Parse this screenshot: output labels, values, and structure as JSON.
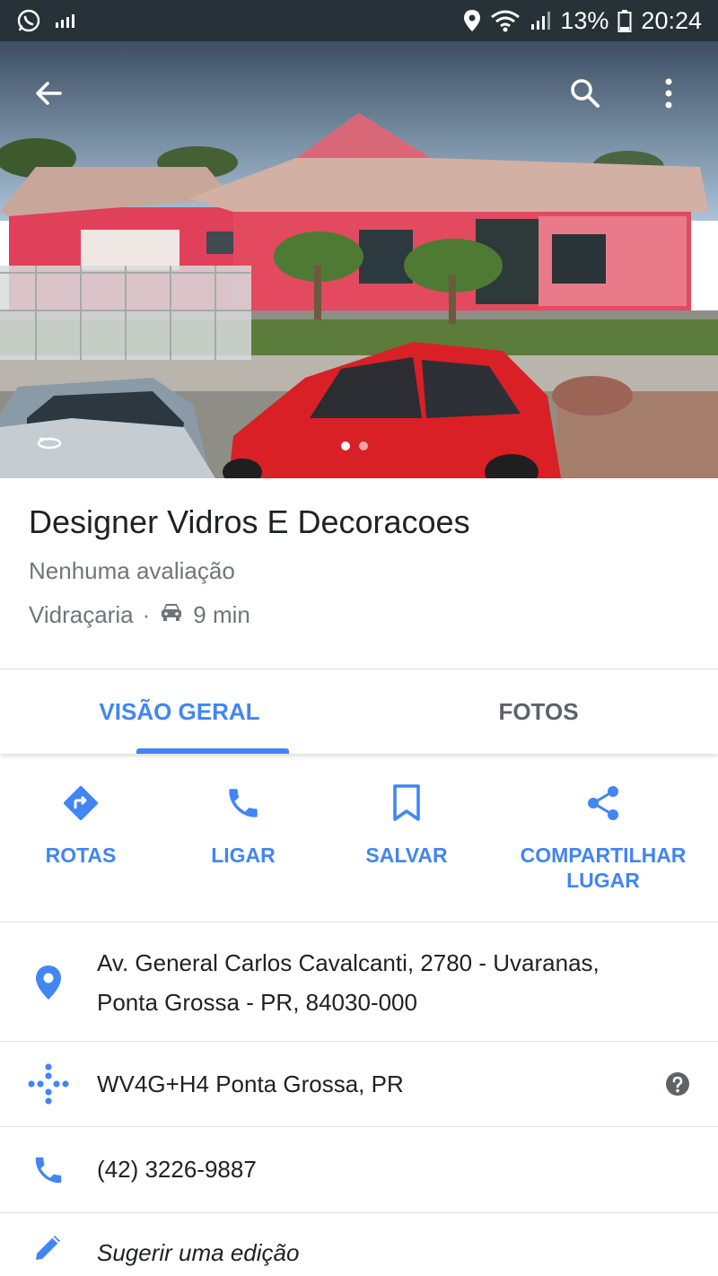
{
  "status_bar": {
    "battery": "13%",
    "time": "20:24"
  },
  "place": {
    "name": "Designer Vidros E Decoracoes",
    "rating_text": "Nenhuma avaliação",
    "category": "Vidraçaria",
    "separator": "·",
    "drive_time": "9 min"
  },
  "tabs": [
    {
      "label": "VISÃO GERAL",
      "active": true
    },
    {
      "label": "FOTOS",
      "active": false
    }
  ],
  "actions": [
    {
      "label": "ROTAS",
      "icon": "directions-icon"
    },
    {
      "label": "LIGAR",
      "icon": "phone-icon"
    },
    {
      "label": "SALVAR",
      "icon": "bookmark-icon"
    },
    {
      "label": "COMPARTILHAR\nLUGAR",
      "icon": "share-icon"
    }
  ],
  "details": {
    "address_line1": "Av. General Carlos Cavalcanti, 2780 - Uvaranas,",
    "address_line2": "Ponta Grossa - PR, 84030-000",
    "plus_code": "WV4G+H4 Ponta Grossa, PR",
    "phone": "(42) 3226-9887",
    "suggest_edit": "Sugerir uma edição"
  },
  "colors": {
    "accent": "#4285f4",
    "status_bar": "#263238",
    "secondary_text": "#70757a"
  }
}
